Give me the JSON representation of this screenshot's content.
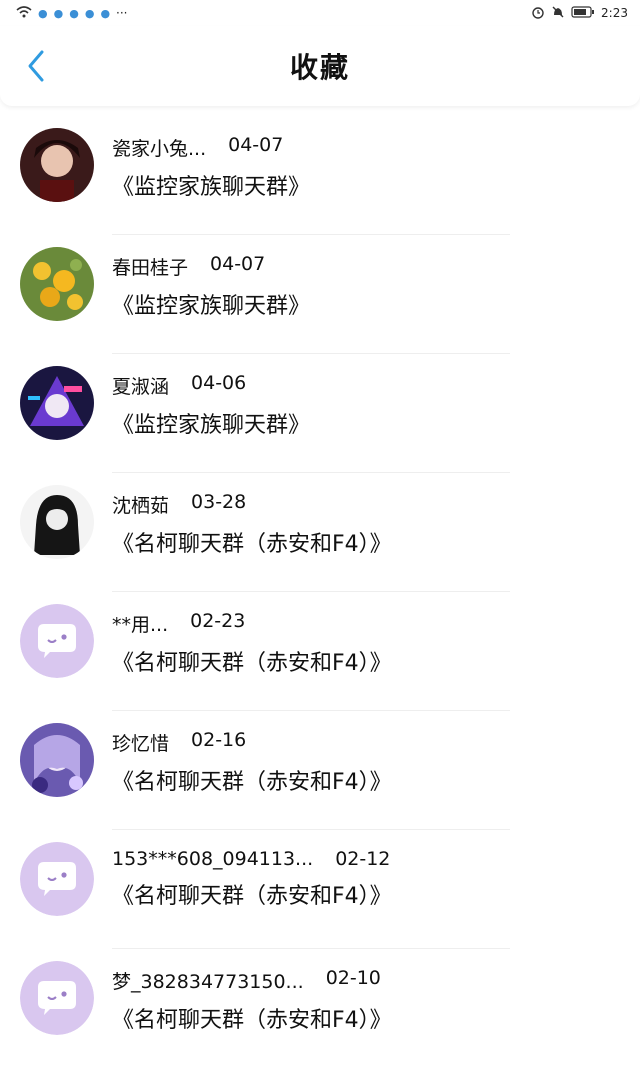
{
  "status_bar": {
    "time": "2:23",
    "dots": "···"
  },
  "header": {
    "title": "收藏",
    "back_icon": "chevron-left-icon"
  },
  "accent_color": "#2f9be0",
  "items": [
    {
      "name": "瓷家小兔...",
      "date": "04-07",
      "group": "《监控家族聊天群》",
      "avatar": "photo"
    },
    {
      "name": "春田桂子",
      "date": "04-07",
      "group": "《监控家族聊天群》",
      "avatar": "photo"
    },
    {
      "name": "夏淑涵",
      "date": "04-06",
      "group": "《监控家族聊天群》",
      "avatar": "photo"
    },
    {
      "name": "沈栖茹",
      "date": "03-28",
      "group": "《名柯聊天群（赤安和F4）》",
      "avatar": "photo"
    },
    {
      "name": "**用...",
      "date": "02-23",
      "group": "《名柯聊天群（赤安和F4）》",
      "avatar": "chat-bubble-icon"
    },
    {
      "name": "珍忆惜",
      "date": "02-16",
      "group": "《名柯聊天群（赤安和F4）》",
      "avatar": "photo"
    },
    {
      "name": "153***608_094113...",
      "date": "02-12",
      "group": "《名柯聊天群（赤安和F4）》",
      "avatar": "chat-bubble-icon"
    },
    {
      "name": "梦_382834773150...",
      "date": "02-10",
      "group": "《名柯聊天群（赤安和F4）》",
      "avatar": "chat-bubble-icon"
    }
  ]
}
